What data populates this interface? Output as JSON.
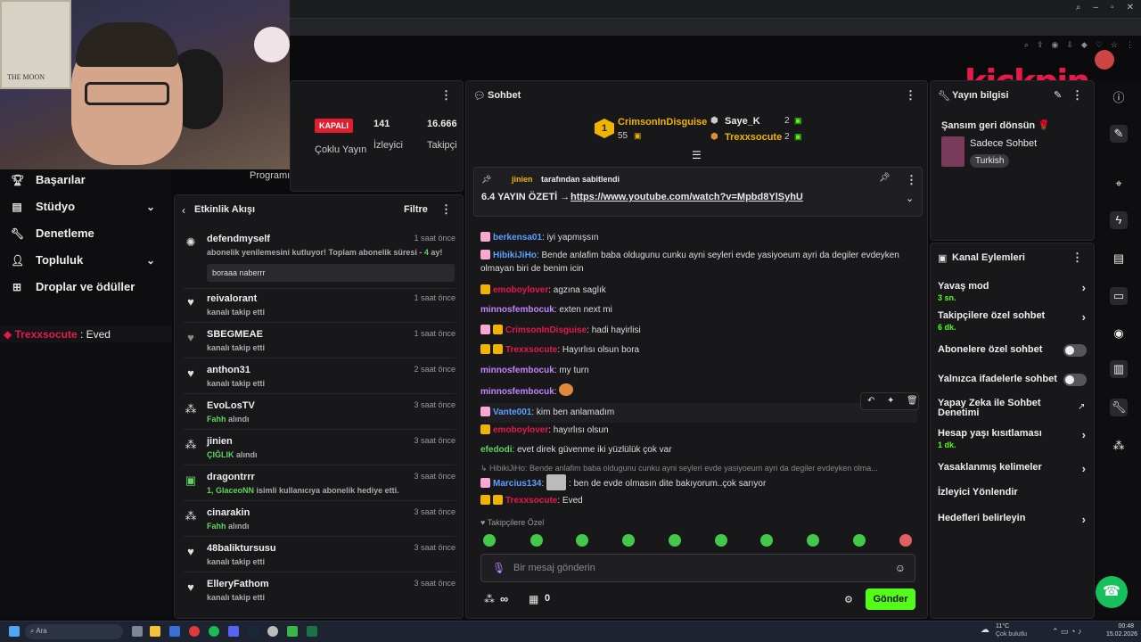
{
  "left_nav": {
    "items": [
      {
        "label": "Başarılar",
        "icon": "trophy-icon"
      },
      {
        "label": "Stüdyo",
        "icon": "studio-icon"
      },
      {
        "label": "Denetleme",
        "icon": "wrench-icon"
      },
      {
        "label": "Topluluk",
        "icon": "community-icon"
      },
      {
        "label": "Droplar ve ödüller",
        "icon": "gift-icon"
      }
    ],
    "chat_preview": {
      "user": "Trexxsocute",
      "text": " : Eved"
    }
  },
  "stats": {
    "status": "KAPALI",
    "multi_stream": "Çoklu Yayın",
    "viewers_value": "141",
    "viewers_label": "İzleyici",
    "followers_value": "16.666",
    "followers_label": "Takipçi",
    "program_partial": "Programı"
  },
  "activity": {
    "title": "Etkinlik Akışı",
    "filter": "Filtre",
    "rows": [
      {
        "name": "defendmyself",
        "sub": "abonelik yenilemesini kutluyor! Toplam abonelik süresi - ",
        "sub_hl": "4",
        "sub_after": " ay!",
        "time": "1 saat önce",
        "note": "boraaa naberrr"
      },
      {
        "name": "reivalorant",
        "sub": "kanalı takip etti",
        "time": "1 saat önce"
      },
      {
        "name": "SBEGMEAE",
        "sub": "kanalı takip etti",
        "time": "1 saat önce"
      },
      {
        "name": "anthon31",
        "sub": "kanalı takip etti",
        "time": "2 saat önce"
      },
      {
        "name": "EvoLosTV",
        "sub_hl": "Fahh",
        "sub": " alındı",
        "time": "3 saat önce"
      },
      {
        "name": "jinien",
        "sub_hl": "ÇIĞLIK",
        "sub": " alındı",
        "time": "3 saat önce"
      },
      {
        "name": "dragontrrr",
        "sub_hl": "1, GlaceoNN",
        "sub": " isimli kullanıcıya abonelik hediye etti.",
        "time": "3 saat önce"
      },
      {
        "name": "cinarakin",
        "sub_hl": "Fahh",
        "sub": " alındı",
        "time": "3 saat önce"
      },
      {
        "name": "48baliktursusu",
        "sub": "kanalı takip etti",
        "time": "3 saat önce"
      },
      {
        "name": "ElleryFathom",
        "sub": "kanalı takip etti",
        "time": "3 saat önce"
      }
    ]
  },
  "chat": {
    "title": "Sohbet",
    "leaderboard": [
      {
        "rank": "1",
        "name": "CrimsonInDisguise",
        "score": "55"
      },
      {
        "name": "Saye_K",
        "score": "2"
      },
      {
        "name": "Trexxsocute",
        "score": "2"
      }
    ],
    "pinned": {
      "by": "jinien",
      "by_suffix": " tarafından sabitlendi",
      "text": "6.4 YAYIN ÖZETİ → ",
      "link": "https://www.youtube.com/watch?v=Mpbd8YlSyhU"
    },
    "messages": [
      {
        "user": "berkensa01",
        "color": "#5aa0ff",
        "text": ": iyi yapmışsın"
      },
      {
        "user": "HibikiJiHo",
        "color": "#5aa0ff",
        "text": ": Bende anlafim baba oldugunu cunku ayni seyleri evde yasiyoeum ayri da degiler evdeyken olmayan biri de benim icin"
      },
      {
        "user": "emoboylover",
        "color": "#e6194b",
        "text": ": agzına saglık"
      },
      {
        "user": "minnosfembocuk",
        "color": "#c084fc",
        "text": ": exten next mi"
      },
      {
        "user": "CrimsonInDisguise",
        "color": "#e6194b",
        "text": ": hadi hayirlisi"
      },
      {
        "user": "Trexxsocute",
        "color": "#e6194b",
        "text": ": Hayırlısı olsun bora"
      },
      {
        "user": "minnosfembocuk",
        "color": "#c084fc",
        "text": ": my turn"
      },
      {
        "user": "minnosfembocuk",
        "color": "#c084fc",
        "text": ":"
      },
      {
        "user": "Vante001",
        "color": "#5aa0ff",
        "text": ": kim ben anlamadım"
      },
      {
        "user": "emoboylover",
        "color": "#e6194b",
        "text": ": hayırlısı olsun"
      },
      {
        "user": "efedodi",
        "color": "#5fd35f",
        "text": ": evet direk güvenme iki yüzlülük çok var"
      },
      {
        "reply": "HibikiJiHo: Bende anlafim baba oldugunu cunku ayni seyleri evde yasiyoeum ayri da degiler evdeyken olma..."
      },
      {
        "user": "Marcius134",
        "color": "#5aa0ff",
        "text": ": ben de evde olmasın dite bakıyorum..çok sarıyor"
      },
      {
        "user": "Trexxsocute",
        "color": "#e6194b",
        "text": ": Eved"
      }
    ],
    "follower_only": "Takipçilere Özel",
    "input_placeholder": "Bir mesaj gönderin",
    "points": "∞",
    "store_count": "0",
    "send_label": "Gönder"
  },
  "info": {
    "title": "Yayın bilgisi",
    "stream_title": "Şansım geri dönsün 🌹",
    "category": "Sadece Sohbet",
    "tag": "Turkish"
  },
  "actions": {
    "title": "Kanal Eylemleri",
    "items": [
      {
        "label": "Yavaş mod",
        "value": "3 sn."
      },
      {
        "label": "Takipçilere özel sohbet",
        "value": "6 dk."
      },
      {
        "label": "Abonelere özel sohbet"
      },
      {
        "label": "Yalnızca ifadelerle sohbet"
      },
      {
        "label": "Yapay Zeka ile Sohbet Denetimi"
      },
      {
        "label": "Hesap yaşı kısıtlaması",
        "value": "1 dk."
      },
      {
        "label": "Yasaklanmış kelimeler"
      },
      {
        "label": "İzleyici Yönlendir"
      },
      {
        "label": "Hedefleri belirleyin"
      }
    ]
  },
  "overlay": {
    "logo": "kickpin",
    "poster": "THE MOON"
  },
  "taskbar": {
    "search": "Ara",
    "weather_temp": "11°C",
    "weather_desc": "Çok bulutlu",
    "time": "00:48",
    "date": "15.02.2026"
  },
  "colors": {
    "accent": "#53fc18",
    "live_red": "#e11d2e",
    "brand": "#e6194b"
  }
}
